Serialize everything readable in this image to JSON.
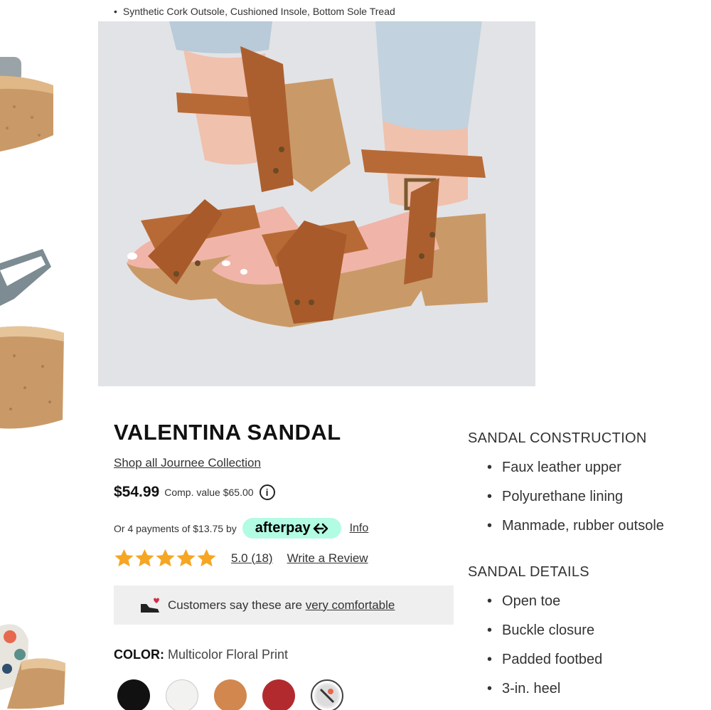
{
  "top_bullet": "Synthetic Cork Outsole, Cushioned Insole, Bottom Sole Tread",
  "product": {
    "title": "VALENTINA SANDAL",
    "shop_link": "Shop all Journee Collection",
    "price": "$54.99",
    "comp_value": "Comp. value $65.00",
    "info_glyph": "i"
  },
  "payment": {
    "text": "Or 4 payments of $13.75 by",
    "provider": "afterpay",
    "info_link": "Info"
  },
  "rating": {
    "stars": 5,
    "value": "5.0 (18)",
    "write_review": "Write a Review"
  },
  "comfort": {
    "prefix": "Customers say these are ",
    "link": "very comfortable"
  },
  "color": {
    "label": "COLOR:",
    "value": " Multicolor Floral Print",
    "swatches": [
      "#111111",
      "#f2f2f0",
      "#d2874e",
      "#b22a2e",
      "multicolor"
    ]
  },
  "construction": {
    "heading": "SANDAL CONSTRUCTION",
    "items": [
      "Faux leather upper",
      "Polyurethane lining",
      "Manmade, rubber outsole"
    ]
  },
  "details": {
    "heading": "SANDAL DETAILS",
    "items": [
      "Open toe",
      "Buckle closure",
      "Padded footbed",
      "3-in. heel"
    ]
  },
  "colors": {
    "star": "#f5a623",
    "afterpay_bg": "#b2fce4",
    "leather": "#b86a36",
    "cork": "#c99a68"
  }
}
